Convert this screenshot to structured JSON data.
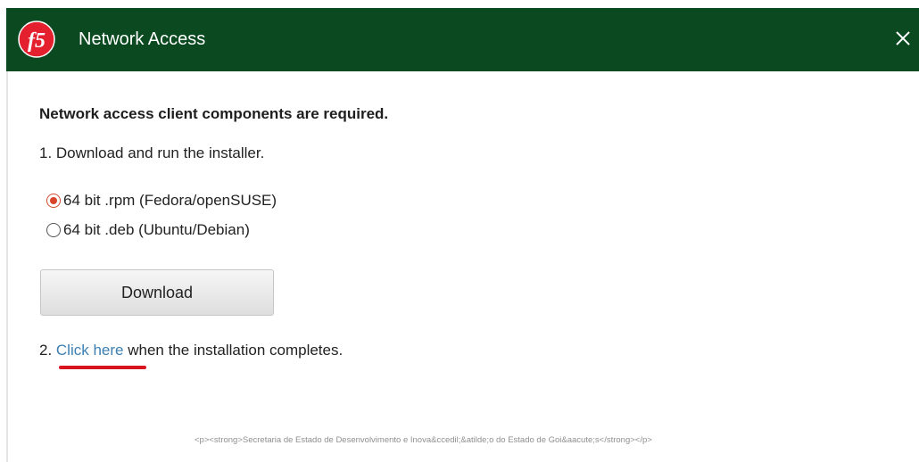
{
  "window": {
    "title": "Network Access",
    "close_symbol": "✕",
    "logo_text": "f5",
    "colors": {
      "titlebar": "#0b4a21",
      "logo": "#e4202e",
      "link": "#3d7fb1",
      "radio_checked": "#d9452a",
      "annotation_underline": "#d9141e"
    }
  },
  "content": {
    "heading": "Network access client components are required.",
    "step1": "1. Download and run the installer.",
    "options": [
      {
        "label": "64 bit .rpm (Fedora/openSUSE)",
        "selected": true
      },
      {
        "label": "64 bit .deb (Ubuntu/Debian)",
        "selected": false
      }
    ],
    "download_label": "Download",
    "step2_prefix": "2. ",
    "step2_link": "Click here",
    "step2_suffix": " when the installation completes."
  },
  "footer": {
    "text": "<p><strong>Secretaria de Estado de Desenvolvimento e Inova&ccedil;&atilde;o do Estado de Goi&aacute;s</strong></p>"
  }
}
